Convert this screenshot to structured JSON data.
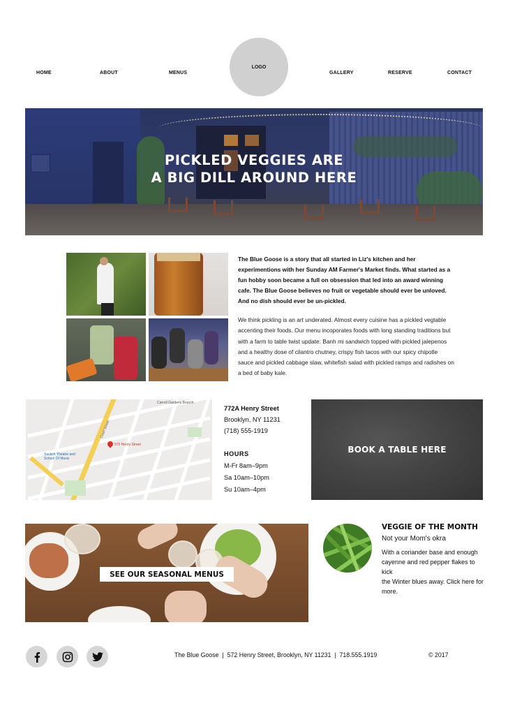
{
  "nav": {
    "items": [
      "HOME",
      "ABOUT",
      "MENUS",
      "GALLERY",
      "RESERVE",
      "CONTACT"
    ],
    "logo": "LOGO"
  },
  "hero": {
    "line1": "PICKLED VEGGIES ARE",
    "line2": "A BIG DILL AROUND HERE"
  },
  "about": {
    "intro": "The Blue Goose is a story that all started in Liz's kitchen and her experimentions with her Sunday AM Farmer's Market finds. What started as a fun hobby soon became a full on obsession that led into an award winning cafe. The Blue Goose believes no fruit or vegetable should ever be unloved. And no dish should ever be un-pickled.",
    "body": "We think pickling is an art underated. Almost every cuisine has a pickled vegtable accenting their foods. Our menu incoporates foods with long standing traditions but with a farm to table twist update: Banh mi sandwich topped with pickled jalepenos and a healthy dose of cilantro chutney, crispy fish tacos with our spicy chipotle sauce and pickled cabbage slaw, whitefish salad with pickled ramps and radishes on a bed of baby kale."
  },
  "map": {
    "pin_label": "572 Henry Street",
    "labels": [
      "Carroll Gardens Branch",
      "Court Street",
      "Sackett Theatre and School Of Music"
    ]
  },
  "location": {
    "street": "772A Henry Street",
    "city": "Brooklyn, NY 11231",
    "phone": "(718) 555-1919",
    "hours_title": "HOURS",
    "hours": [
      "M-Fr 8am–9pm",
      "Sa 10am–10pm",
      "Su 10am–4pm"
    ]
  },
  "book": {
    "label": "BOOK A TABLE HERE"
  },
  "seasonal": {
    "label": "SEE OUR SEASONAL MENUS"
  },
  "veggie": {
    "title": "VEGGIE OF THE MONTH",
    "subtitle": "Not your Mom's okra",
    "desc": [
      "With a coriander base and enough",
      "cayenne and red pepper flakes to kick",
      "the Winter blues away. Click here for more."
    ]
  },
  "footer": {
    "info": "The Blue Goose  |  572 Henry Street, Brooklyn, NY 11231  |  718.555.1919",
    "copyright": "© 2017",
    "social": [
      "facebook-icon",
      "instagram-icon",
      "twitter-icon"
    ]
  },
  "colors": {
    "logo_bg": "#d0d0d0",
    "book_bg": "#444444",
    "social_bg": "#d6d6d6"
  }
}
